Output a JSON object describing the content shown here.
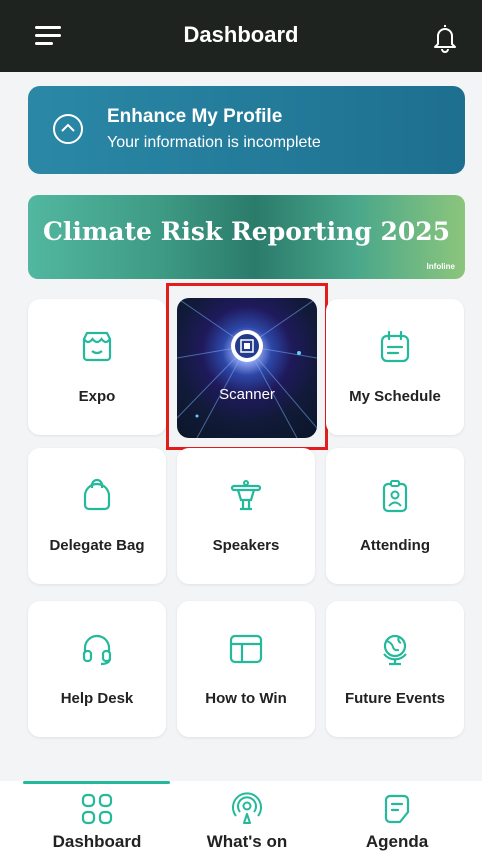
{
  "header": {
    "title": "Dashboard"
  },
  "profile": {
    "title": "Enhance My Profile",
    "subtitle": "Your information is incomplete"
  },
  "banner": {
    "title": "Climate Risk Reporting 2025",
    "brand": "Infoline"
  },
  "tiles": {
    "expo": "Expo",
    "scanner": "Scanner",
    "schedule": "My Schedule",
    "delegate_bag": "Delegate Bag",
    "speakers": "Speakers",
    "attending": "Attending",
    "help_desk": "Help Desk",
    "how_to_win": "How to Win",
    "future_events": "Future Events"
  },
  "tabs": {
    "dashboard": "Dashboard",
    "whats_on": "What's on",
    "agenda": "Agenda"
  },
  "colors": {
    "accent": "#23b99a",
    "header": "#1f231f",
    "profile": "#1e6f8f",
    "highlight": "#e31c1c"
  }
}
